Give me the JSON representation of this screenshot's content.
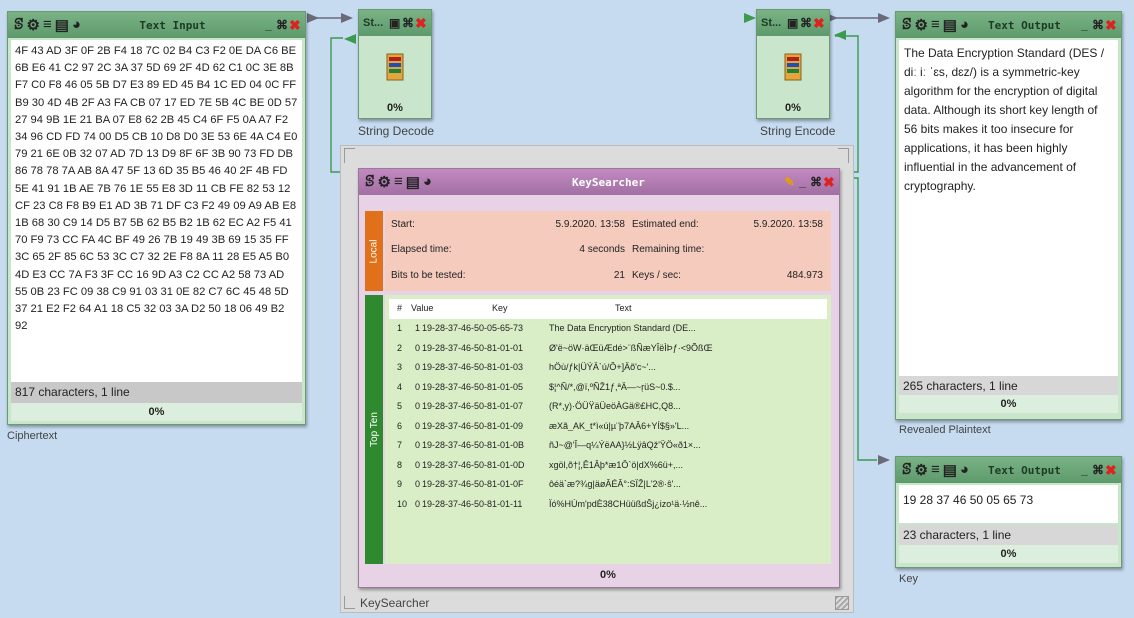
{
  "text_input": {
    "title": "Text Input",
    "content": "4F 43 AD 3F 0F 2B F4 18 7C 02 B4 C3 F2 0E DA C6 BE 6B E6 41 C2 97 2C 3A 37 5D 69 2F 4D 62 C1 0C 3E 8B F7 C0 F8 46 05 5B D7 E3 89 ED 45 B4 1C ED 04 0C FF B9 30 4D 4B 2F A3 FA CB 07 17 ED 7E 5B 4C BE 0D 57 27 94 9B 1E 21 BA 07 E8 62 2B 45 C4 6F F5 0A A7 F2 34 96 CD FD 74 00 D5 CB 10 D8 D0 3E 53 6E 4A C4 E0 79 21 6E 0B 32 07 AD 7D 13 D9 8F 6F 3B 90 73 FD DB 86 78 78 7A AB 8A 47 5F 13 6D 35 B5 46 40 2F 4B FD 5E 41 91 1B AE 7B 76 1E 55 E8 3D 11 CB FE 82 53 12 CF 23 C8 F8 B9 E1 AD 3B 71 DF C3 F2 49 09 A9 AB E8 1B 68 30 C9 14 D5 B7 5B 62 B5 B2 1B 62 EC A2 F5 41 70 F9 73 CC FA 4C BF 49 26 7B 19 49 3B 69 15 35 FF 3C 65 2F 85 6C 53 3C C7 32 2E F8 8A 11 28 E5 A5 B0 4D E3 CC 7A F3 3F CC 16 9D A3 C2 CC A2 58 73 AD 55 0B 23 FC 09 38 C9 91 03 31 0E 82 C7 6C 45 48 5D 37 21 E2 F2 64 A1 18 C5 32 03 3A D2 50 18 06 49 B2 92",
    "status": "817 characters,  1 line",
    "progress": "0%",
    "caption": "Ciphertext"
  },
  "string_decode": {
    "title": "St...",
    "progress": "0%",
    "caption": "String Decode"
  },
  "string_encode": {
    "title": "St...",
    "progress": "0%",
    "caption": "String Encode"
  },
  "text_output_1": {
    "title": "Text Output",
    "content": "The Data Encryption Standard (DES / diː iː ˈɛs, dɛz/) is a symmetric-key algorithm for the encryption of digital data. Although its short key length of 56 bits makes it too insecure for applications, it has been highly influential in the advancement of cryptography.",
    "status": "265 characters,  1 line",
    "progress": "0%",
    "caption": "Revealed Plaintext"
  },
  "text_output_2": {
    "title": "Text Output",
    "content": "19 28 37 46 50 05 65 73",
    "status": "23 characters,  1 line",
    "progress": "0%",
    "caption": "Key"
  },
  "keysearcher": {
    "title": "KeySearcher",
    "caption": "KeySearcher",
    "progress": "0%",
    "local_tab": "Local",
    "topten_tab": "Top Ten",
    "start_label": "Start:",
    "start_value": "5.9.2020. 13:58",
    "est_end_label": "Estimated end:",
    "est_end_value": "5.9.2020. 13:58",
    "elapsed_label": "Elapsed time:",
    "elapsed_value": "4 seconds",
    "remaining_label": "Remaining time:",
    "remaining_value": "",
    "bits_label": "Bits to be tested:",
    "bits_value": "21",
    "keys_label": "Keys / sec:",
    "keys_value": "484.973",
    "columns": [
      "#",
      "Value",
      "Key",
      "Text"
    ],
    "rows": [
      {
        "n": "1",
        "value": "1",
        "key": "19-28-37-46-50-05-65-73",
        "text": "The Data Encryption Standard (DE..."
      },
      {
        "n": "2",
        "value": "0",
        "key": "19-28-37-46-50-81-01-01",
        "text": "Ø'ë~öW·äŒüÆdé>¨ßÑæYÎëÌÞƒ·<9ÕßŒ"
      },
      {
        "n": "3",
        "value": "0",
        "key": "19-28-37-46-50-81-01-03",
        "text": "hÖù/ƒk|ÜÝÄ`ú/Ô+]Äõ'c~'..."
      },
      {
        "n": "4",
        "value": "0",
        "key": "19-28-37-46-50-81-01-05",
        "text": "$¦^Ñ/*,@ï,ºÑŽ1ƒ,ªÄ—~ŗüS~0.$..."
      },
      {
        "n": "5",
        "value": "0",
        "key": "19-28-37-46-50-81-01-07",
        "text": "(R*,y)·ÖÜŸäÜeöÀGä®£HC,Q8..."
      },
      {
        "n": "6",
        "value": "0",
        "key": "19-28-37-46-50-81-01-09",
        "text": "æXã_AK_t*ì«ú|µ¨þ7AÂ6+YÍ$§»'L..."
      },
      {
        "n": "7",
        "value": "0",
        "key": "19-28-37-46-50-81-01-0B",
        "text": "ñJ~@'Î—q¼ÝëAA}½LÿâQž'ŸÖ«ð1×..."
      },
      {
        "n": "8",
        "value": "0",
        "key": "19-28-37-46-50-81-01-0D",
        "text": "xgöl,õ†¦,Ê1Âþ*æ1Ô`ö|dX%6ü+,..."
      },
      {
        "n": "9",
        "value": "0",
        "key": "19-28-37-46-50-81-01-0F",
        "text": "ôéä`æ?¾g|äøÂÉÂ°:SÏŽ|L'2®·ŝ'..."
      },
      {
        "n": "10",
        "value": "0",
        "key": "19-28-37-46-50-81-01-11",
        "text": "Ïó%HÙm'pdÈ38CHüüßdŠj¿izo¹ä·½nê..."
      }
    ]
  }
}
